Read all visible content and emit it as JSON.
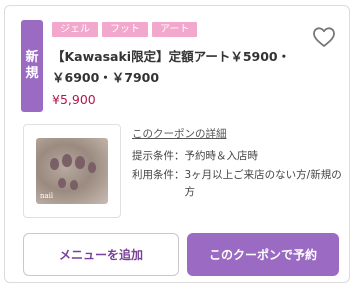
{
  "badge": {
    "line1": "新",
    "line2": "規"
  },
  "tags": [
    "ジェル",
    "フット",
    "アート"
  ],
  "coupon": {
    "title_line1": "【Kawasaki限定】定額アート￥5900・",
    "title_line2": "￥6900・￥7900",
    "price": "¥5,900"
  },
  "details": {
    "link_label": "このクーポンの詳細",
    "presentation_label": "提示条件：",
    "presentation_value": "予約時＆入店時",
    "usage_label": "利用条件：",
    "usage_value": "3ヶ月以上ご来店のない方/新規の方"
  },
  "thumbnail": {
    "caption": "nail"
  },
  "buttons": {
    "add_menu": "メニューを追加",
    "reserve": "このクーポンで予約"
  },
  "icons": {
    "favorite": "heart-outline-icon"
  },
  "colors": {
    "accent": "#9b6bc4",
    "tag": "#f2a7cc",
    "price": "#b5174a",
    "button_text": "#7a3f9a"
  }
}
